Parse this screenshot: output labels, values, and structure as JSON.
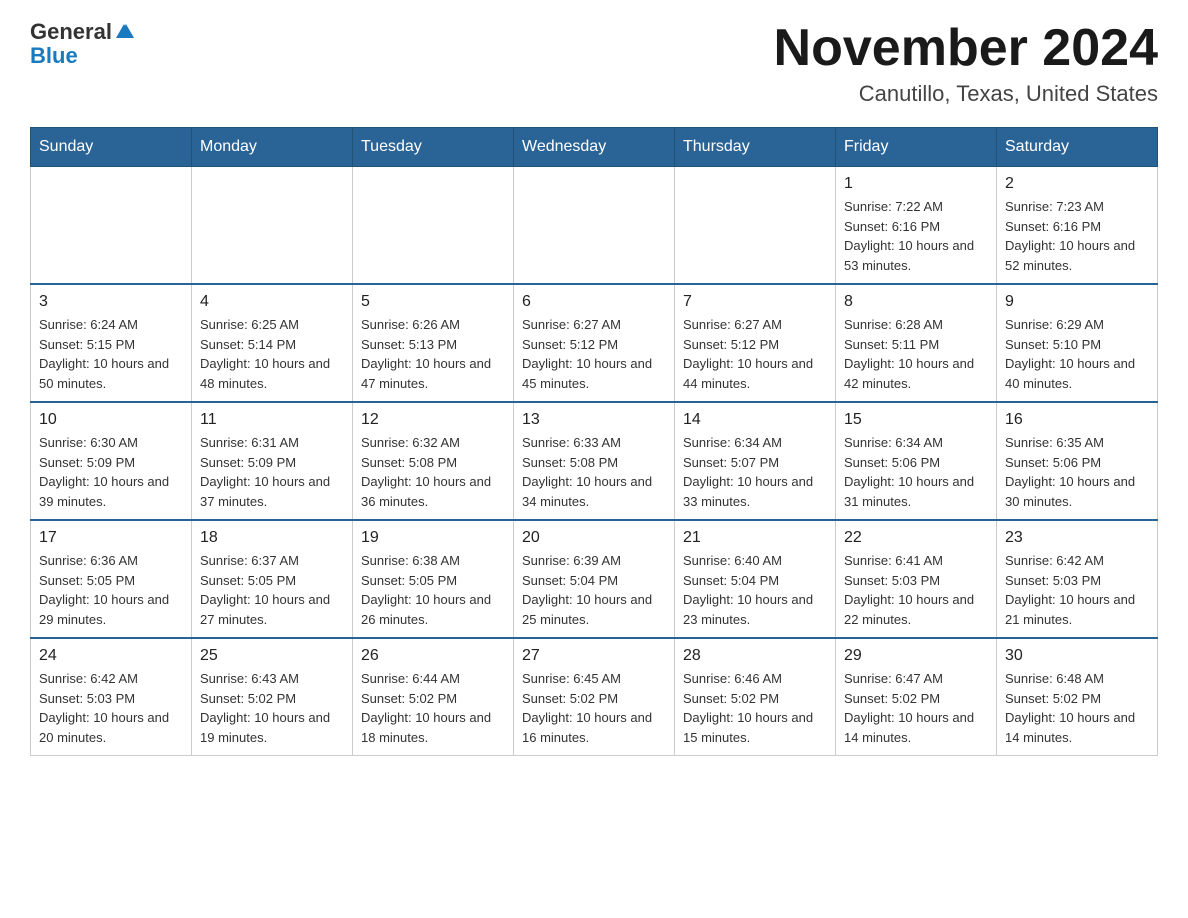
{
  "header": {
    "logo_general": "General",
    "logo_blue": "Blue",
    "month_title": "November 2024",
    "location": "Canutillo, Texas, United States"
  },
  "days_of_week": [
    "Sunday",
    "Monday",
    "Tuesday",
    "Wednesday",
    "Thursday",
    "Friday",
    "Saturday"
  ],
  "weeks": [
    {
      "days": [
        {
          "num": "",
          "info": ""
        },
        {
          "num": "",
          "info": ""
        },
        {
          "num": "",
          "info": ""
        },
        {
          "num": "",
          "info": ""
        },
        {
          "num": "",
          "info": ""
        },
        {
          "num": "1",
          "info": "Sunrise: 7:22 AM\nSunset: 6:16 PM\nDaylight: 10 hours and 53 minutes."
        },
        {
          "num": "2",
          "info": "Sunrise: 7:23 AM\nSunset: 6:16 PM\nDaylight: 10 hours and 52 minutes."
        }
      ]
    },
    {
      "days": [
        {
          "num": "3",
          "info": "Sunrise: 6:24 AM\nSunset: 5:15 PM\nDaylight: 10 hours and 50 minutes."
        },
        {
          "num": "4",
          "info": "Sunrise: 6:25 AM\nSunset: 5:14 PM\nDaylight: 10 hours and 48 minutes."
        },
        {
          "num": "5",
          "info": "Sunrise: 6:26 AM\nSunset: 5:13 PM\nDaylight: 10 hours and 47 minutes."
        },
        {
          "num": "6",
          "info": "Sunrise: 6:27 AM\nSunset: 5:12 PM\nDaylight: 10 hours and 45 minutes."
        },
        {
          "num": "7",
          "info": "Sunrise: 6:27 AM\nSunset: 5:12 PM\nDaylight: 10 hours and 44 minutes."
        },
        {
          "num": "8",
          "info": "Sunrise: 6:28 AM\nSunset: 5:11 PM\nDaylight: 10 hours and 42 minutes."
        },
        {
          "num": "9",
          "info": "Sunrise: 6:29 AM\nSunset: 5:10 PM\nDaylight: 10 hours and 40 minutes."
        }
      ]
    },
    {
      "days": [
        {
          "num": "10",
          "info": "Sunrise: 6:30 AM\nSunset: 5:09 PM\nDaylight: 10 hours and 39 minutes."
        },
        {
          "num": "11",
          "info": "Sunrise: 6:31 AM\nSunset: 5:09 PM\nDaylight: 10 hours and 37 minutes."
        },
        {
          "num": "12",
          "info": "Sunrise: 6:32 AM\nSunset: 5:08 PM\nDaylight: 10 hours and 36 minutes."
        },
        {
          "num": "13",
          "info": "Sunrise: 6:33 AM\nSunset: 5:08 PM\nDaylight: 10 hours and 34 minutes."
        },
        {
          "num": "14",
          "info": "Sunrise: 6:34 AM\nSunset: 5:07 PM\nDaylight: 10 hours and 33 minutes."
        },
        {
          "num": "15",
          "info": "Sunrise: 6:34 AM\nSunset: 5:06 PM\nDaylight: 10 hours and 31 minutes."
        },
        {
          "num": "16",
          "info": "Sunrise: 6:35 AM\nSunset: 5:06 PM\nDaylight: 10 hours and 30 minutes."
        }
      ]
    },
    {
      "days": [
        {
          "num": "17",
          "info": "Sunrise: 6:36 AM\nSunset: 5:05 PM\nDaylight: 10 hours and 29 minutes."
        },
        {
          "num": "18",
          "info": "Sunrise: 6:37 AM\nSunset: 5:05 PM\nDaylight: 10 hours and 27 minutes."
        },
        {
          "num": "19",
          "info": "Sunrise: 6:38 AM\nSunset: 5:05 PM\nDaylight: 10 hours and 26 minutes."
        },
        {
          "num": "20",
          "info": "Sunrise: 6:39 AM\nSunset: 5:04 PM\nDaylight: 10 hours and 25 minutes."
        },
        {
          "num": "21",
          "info": "Sunrise: 6:40 AM\nSunset: 5:04 PM\nDaylight: 10 hours and 23 minutes."
        },
        {
          "num": "22",
          "info": "Sunrise: 6:41 AM\nSunset: 5:03 PM\nDaylight: 10 hours and 22 minutes."
        },
        {
          "num": "23",
          "info": "Sunrise: 6:42 AM\nSunset: 5:03 PM\nDaylight: 10 hours and 21 minutes."
        }
      ]
    },
    {
      "days": [
        {
          "num": "24",
          "info": "Sunrise: 6:42 AM\nSunset: 5:03 PM\nDaylight: 10 hours and 20 minutes."
        },
        {
          "num": "25",
          "info": "Sunrise: 6:43 AM\nSunset: 5:02 PM\nDaylight: 10 hours and 19 minutes."
        },
        {
          "num": "26",
          "info": "Sunrise: 6:44 AM\nSunset: 5:02 PM\nDaylight: 10 hours and 18 minutes."
        },
        {
          "num": "27",
          "info": "Sunrise: 6:45 AM\nSunset: 5:02 PM\nDaylight: 10 hours and 16 minutes."
        },
        {
          "num": "28",
          "info": "Sunrise: 6:46 AM\nSunset: 5:02 PM\nDaylight: 10 hours and 15 minutes."
        },
        {
          "num": "29",
          "info": "Sunrise: 6:47 AM\nSunset: 5:02 PM\nDaylight: 10 hours and 14 minutes."
        },
        {
          "num": "30",
          "info": "Sunrise: 6:48 AM\nSunset: 5:02 PM\nDaylight: 10 hours and 14 minutes."
        }
      ]
    }
  ]
}
